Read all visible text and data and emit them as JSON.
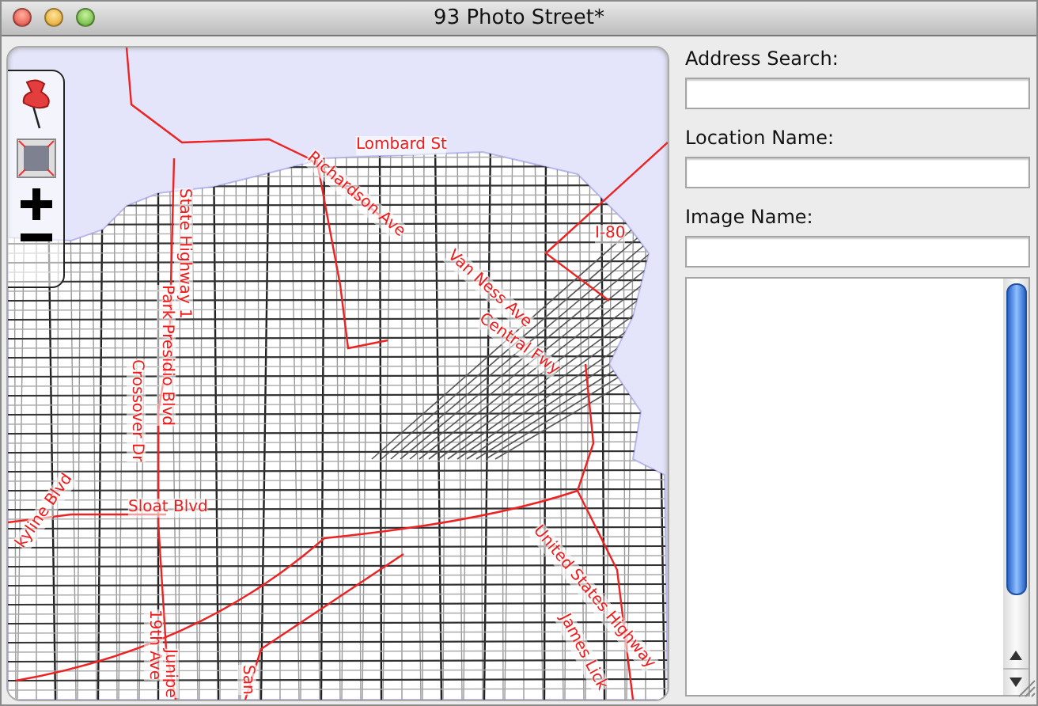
{
  "window": {
    "title": "93 Photo Street*"
  },
  "map": {
    "labels": [
      {
        "text": "Lombard St"
      },
      {
        "text": "Richardson Ave"
      },
      {
        "text": "State Highway 1"
      },
      {
        "text": "Park Presidio Blvd"
      },
      {
        "text": "Crossover Dr"
      },
      {
        "text": "Van Ness Ave"
      },
      {
        "text": "Central Fwy"
      },
      {
        "text": "I-80"
      },
      {
        "text": "Sloat Blvd"
      },
      {
        "text": "kyline Blvd"
      },
      {
        "text": "19th Ave"
      },
      {
        "text": "Junipe"
      },
      {
        "text": "San"
      },
      {
        "text": "United States Highway"
      },
      {
        "text": "James Lick"
      }
    ]
  },
  "tools": [
    {
      "kind": "pin"
    },
    {
      "kind": "select"
    },
    {
      "kind": "zoom-in"
    },
    {
      "kind": "zoom-out"
    }
  ],
  "form": {
    "fields": [
      {
        "label": "Address Search:"
      },
      {
        "label": "Location Name:"
      },
      {
        "label": "Image Name:"
      }
    ]
  }
}
